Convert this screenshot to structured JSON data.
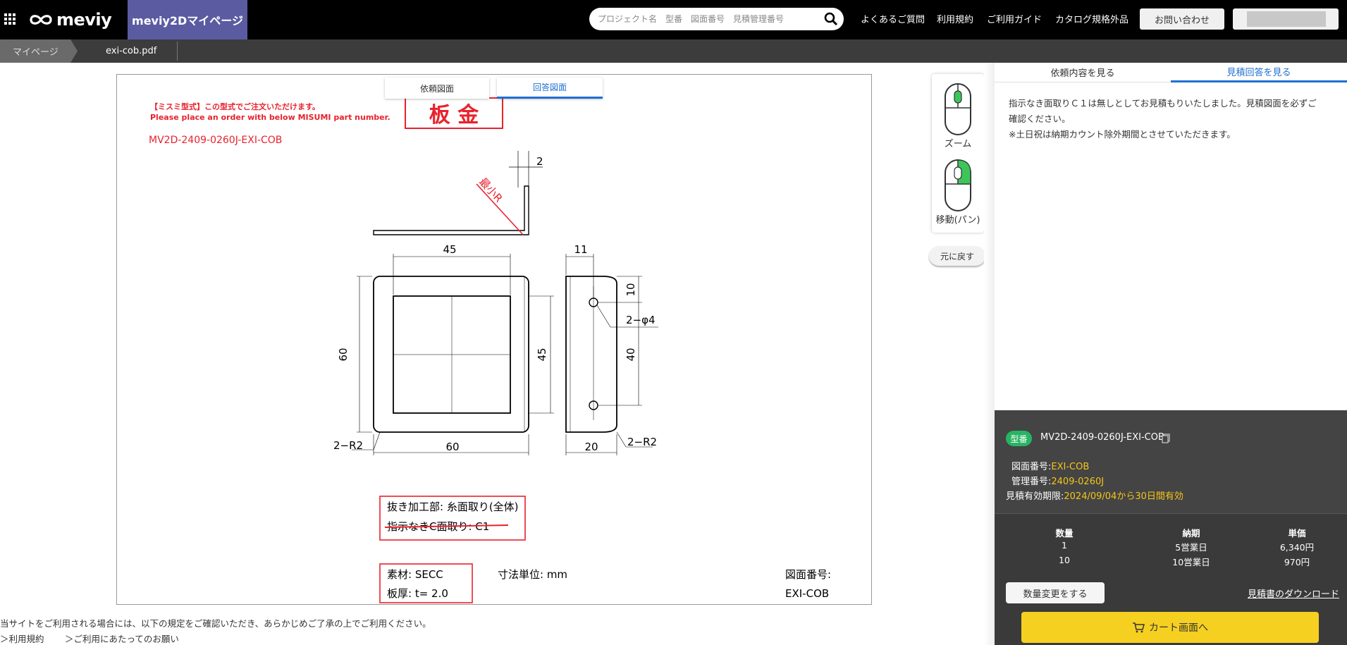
{
  "header": {
    "logo_text": "meviy",
    "mypage_tab": "meviy2Dマイページ",
    "search_placeholder": "プロジェクト名　型番　図面番号　見積管理番号",
    "nav": [
      "よくあるご質問",
      "利用規約",
      "ご利用ガイド",
      "カタログ規格外品"
    ],
    "contact_button": "お問い合わせ"
  },
  "breadcrumb": {
    "home": "マイページ",
    "file": "exi-cob.pdf"
  },
  "viewer": {
    "tabs": {
      "request": "依頼図面",
      "answer": "回答図面"
    },
    "drawing": {
      "note_line1": "【ミスミ型式】この型式でご注文いただけます。",
      "note_line2": "Please place an order with below MISUMI part number.",
      "part_number": "MV2D-2409-0260J-EXI-COB",
      "stamp": "板 金",
      "min_r": "最小R",
      "dim_2": "2",
      "dim_45_top": "45",
      "dim_11": "11",
      "dim_60_left": "60",
      "dim_45_right": "45",
      "dim_10": "10",
      "dim_hole": "2−φ4",
      "dim_40": "40",
      "dim_60_bottom": "60",
      "dim_20": "20",
      "r_left": "2−R2",
      "r_right": "2−R2",
      "spec1": "抜き加工部: 糸面取り(全体)",
      "spec2": "指示なきC面取り: C1",
      "material": "素材: SECC",
      "thickness": "板厚: t= 2.0",
      "unit": "寸法単位: mm",
      "drawing_no_label": "図面番号:",
      "drawing_no": "EXI-COB"
    },
    "mouse_zoom_label": "ズーム",
    "mouse_pan_label": "移動(パン)",
    "reset_button": "元に戻す"
  },
  "right_panel": {
    "tabs": [
      "依頼内容を見る",
      "見積回答を見る"
    ],
    "message": [
      "指示なき面取りＣ１は無しとしてお見積もりいたしました。見積図面を必ずご",
      "確認ください。",
      "※土日祝は納期カウント除外期間とさせていただきます。"
    ],
    "badge": "型番",
    "part_number": "MV2D-2409-0260J-EXI-COB",
    "drawing_no_label": "図面番号:",
    "drawing_no": "EXI-COB",
    "mgmt_no_label": "管理番号:",
    "mgmt_no": "2409-0260J",
    "validity_label": "見積有効期限:",
    "validity": "2024/09/04から30日間有効",
    "table": {
      "headers": [
        "数量",
        "納期",
        "単価"
      ],
      "rows": [
        [
          "1",
          "5営業日",
          "6,340円"
        ],
        [
          "10",
          "10営業日",
          "970円"
        ]
      ]
    },
    "change_qty_button": "数量変更をする",
    "download_link": "見積書のダウンロード",
    "cart_button": "カート画面へ"
  },
  "footer": {
    "notice": "当サイトをご利用される場合には、以下の規定をご確認いただき、あらかじめご了承の上でご利用ください。",
    "links": [
      "＞利用規約",
      "＞ご利用にあたってのお願い"
    ]
  },
  "colors": {
    "accent_blue": "#1f6fd1",
    "mypage_purple": "#5b5ba2",
    "badge_green": "#28b463",
    "cart_yellow": "#f5d020",
    "drawing_red": "#e8222d"
  }
}
